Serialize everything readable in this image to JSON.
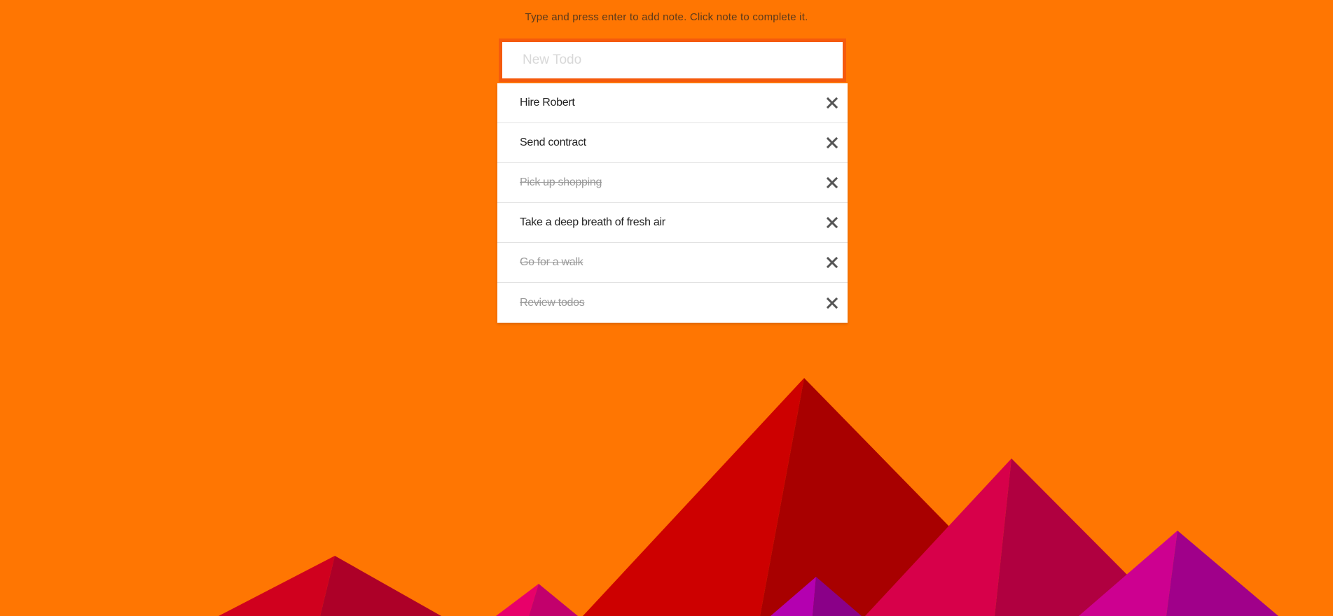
{
  "header": {
    "instructions": "Type and press enter to add note. Click note to complete it."
  },
  "input": {
    "placeholder": "New Todo",
    "value": ""
  },
  "todos": [
    {
      "text": "Hire Robert",
      "completed": false
    },
    {
      "text": "Send contract",
      "completed": false
    },
    {
      "text": "Pick up shopping",
      "completed": true
    },
    {
      "text": "Take a deep breath of fresh air",
      "completed": false
    },
    {
      "text": "Go for a walk",
      "completed": true
    },
    {
      "text": "Review todos",
      "completed": true
    }
  ],
  "icons": {
    "remove": "close-icon"
  },
  "colors": {
    "background": "#ff7602",
    "input_border": "#f55a0c",
    "completed_text": "#9a9a9a",
    "remove_icon": "#555555"
  }
}
